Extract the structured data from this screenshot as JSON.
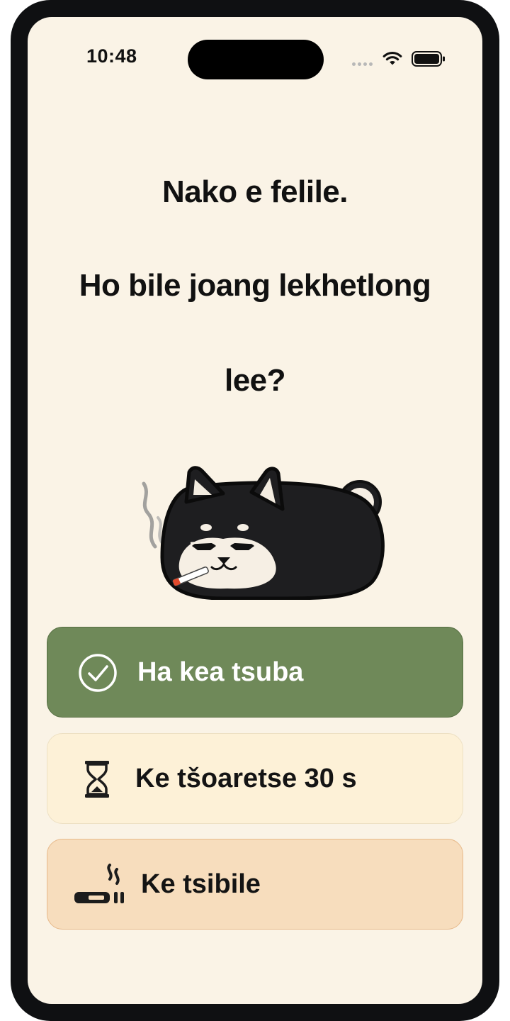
{
  "status_bar": {
    "time": "10:48"
  },
  "question": {
    "line1": "Nako e felile.",
    "line2": "Ho bile joang lekhetlong",
    "line3": "lee?"
  },
  "options": [
    {
      "label": "Ha kea tsuba",
      "icon": "check-circle-icon",
      "color": "#6f8959"
    },
    {
      "label": "Ke tšoaretse 30 s",
      "icon": "hourglass-icon",
      "color": "#fdf1d7"
    },
    {
      "label": "Ke tsibile",
      "icon": "cigarette-icon",
      "color": "#f7ddbd"
    }
  ],
  "mascot": {
    "icon": "smoking-dog-mascot"
  }
}
